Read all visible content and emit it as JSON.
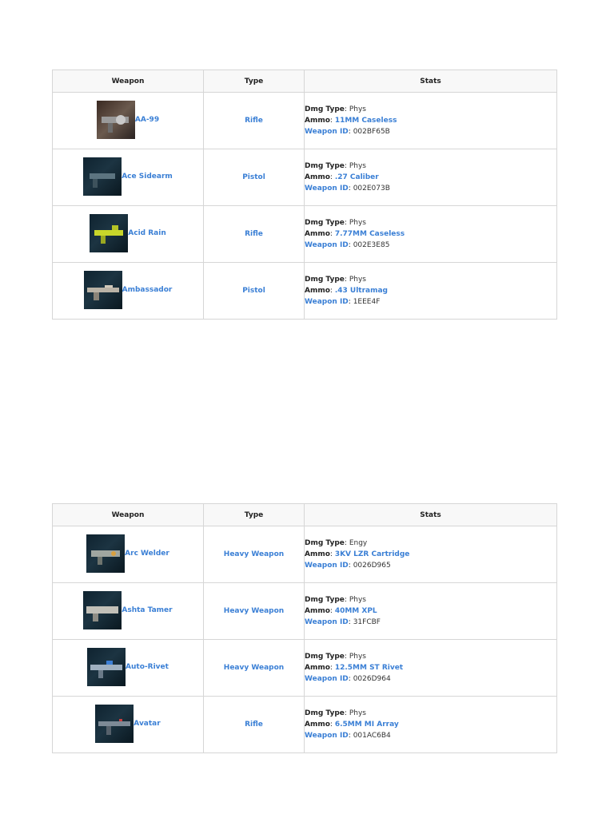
{
  "headers": {
    "weapon": "Weapon",
    "type": "Type",
    "stats": "Stats"
  },
  "stat_labels": {
    "dmg": "Dmg Type",
    "ammo": "Ammo",
    "id": "Weapon ID"
  },
  "table1": [
    {
      "name": "AA-99",
      "type": "Rifle",
      "dmg": "Phys",
      "ammo": "11MM Caseless",
      "id": "002BF65B",
      "thumb": "brown"
    },
    {
      "name": "Ace Sidearm",
      "type": "Pistol",
      "dmg": "Phys",
      "ammo": ".27 Caliber",
      "id": "002E073B",
      "thumb": "dark"
    },
    {
      "name": "Acid Rain",
      "type": "Rifle",
      "dmg": "Phys",
      "ammo": "7.77MM Caseless",
      "id": "002E3E85",
      "thumb": "yellow"
    },
    {
      "name": "Ambassador",
      "type": "Pistol",
      "dmg": "Phys",
      "ammo": ".43 Ultramag",
      "id": "1EEE4F",
      "thumb": "dark"
    }
  ],
  "table2": [
    {
      "name": "Arc Welder",
      "type": "Heavy Weapon",
      "dmg": "Engy",
      "ammo": "3KV LZR Cartridge",
      "id": "0026D965",
      "thumb": "dark"
    },
    {
      "name": "Ashta Tamer",
      "type": "Heavy Weapon",
      "dmg": "Phys",
      "ammo": "40MM XPL",
      "id": "31FCBF",
      "thumb": "dark"
    },
    {
      "name": "Auto-Rivet",
      "type": "Heavy Weapon",
      "dmg": "Phys",
      "ammo": "12.5MM ST Rivet",
      "id": "0026D964",
      "thumb": "dark"
    },
    {
      "name": "Avatar",
      "type": "Rifle",
      "dmg": "Phys",
      "ammo": "6.5MM MI Array",
      "id": "001AC6B4",
      "thumb": "dark"
    }
  ]
}
